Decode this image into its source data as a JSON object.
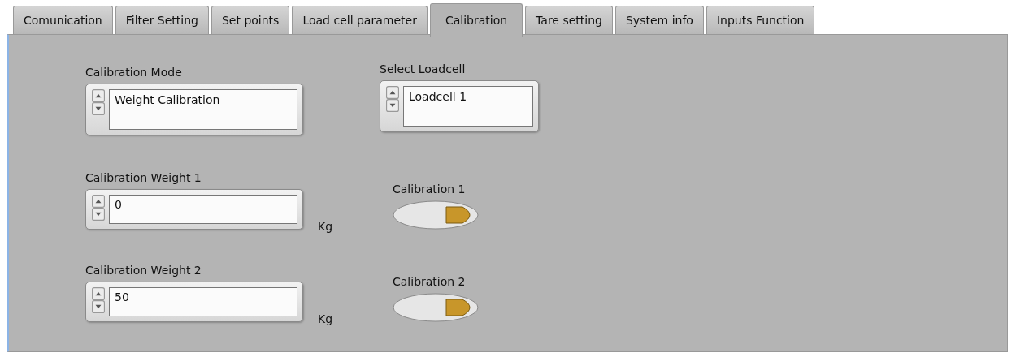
{
  "tabs": [
    {
      "label": "Comunication",
      "selected": false
    },
    {
      "label": "Filter Setting",
      "selected": false
    },
    {
      "label": "Set points",
      "selected": false
    },
    {
      "label": "Load cell parameter",
      "selected": false
    },
    {
      "label": "Calibration",
      "selected": true
    },
    {
      "label": "Tare setting",
      "selected": false
    },
    {
      "label": "System info",
      "selected": false
    },
    {
      "label": "Inputs Function",
      "selected": false
    }
  ],
  "calibration_mode": {
    "label": "Calibration Mode",
    "value": "Weight Calibration"
  },
  "select_loadcell": {
    "label": "Select Loadcell",
    "value": "Loadcell 1"
  },
  "weights": [
    {
      "label": "Calibration Weight 1",
      "value": "0",
      "unit": "Kg",
      "button_label": "Calibration  1",
      "on": false
    },
    {
      "label": "Calibration Weight 2",
      "value": "50",
      "unit": "Kg",
      "button_label": "Calibration 2",
      "on": false
    }
  ]
}
